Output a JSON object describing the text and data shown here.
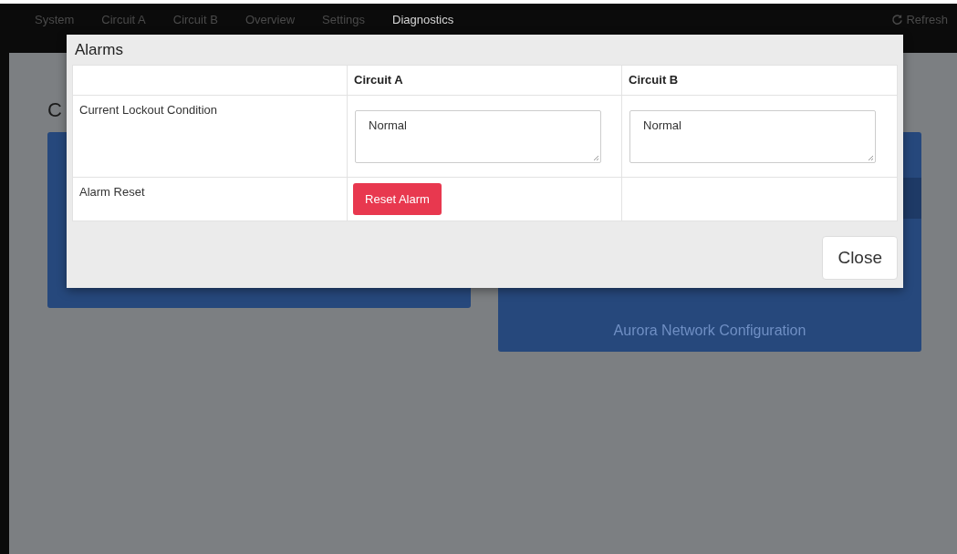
{
  "nav": {
    "items": [
      {
        "label": "System",
        "selected": false
      },
      {
        "label": "Circuit A",
        "selected": false
      },
      {
        "label": "Circuit B",
        "selected": false
      },
      {
        "label": "Overview",
        "selected": false
      },
      {
        "label": "Settings",
        "selected": false
      },
      {
        "label": "Diagnostics",
        "selected": true
      }
    ],
    "refresh": "Refresh"
  },
  "page": {
    "heading": "C",
    "right_card": {
      "label": "Aurora Network Configuration"
    }
  },
  "modal": {
    "title": "Alarms",
    "columns": [
      "Circuit A",
      "Circuit B"
    ],
    "rows": [
      {
        "kind": "fields",
        "label": "Current Lockout Condition",
        "values": [
          "Normal",
          "Normal"
        ]
      },
      {
        "kind": "button",
        "label": "Alarm Reset",
        "button": "Reset Alarm"
      }
    ],
    "close": "Close"
  }
}
